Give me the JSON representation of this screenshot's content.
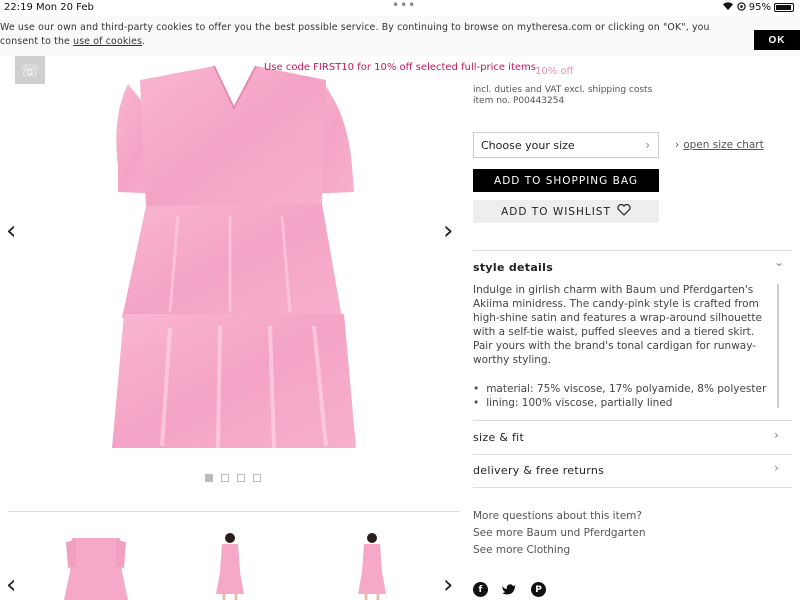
{
  "status_bar": {
    "time": "22:19",
    "date": "Mon 20 Feb",
    "dots": "•••",
    "battery": "95%"
  },
  "cookie_banner": {
    "text": "We use our own and third-party cookies to offer you the best possible service. By continuing to browse on mytheresa.com or clicking on \"OK\", you consent to the",
    "link": "use of cookies",
    "ok_label": "OK"
  },
  "promo": "Use code FIRST10 for 10% off selected full-price items",
  "product": {
    "price_badge": "10% off",
    "shipping": "incl. duties and VAT excl. shipping costs",
    "item_no": "item no. P00443254",
    "size_select": "Choose your size",
    "size_chart": "open size chart",
    "add_to_bag": "ADD TO SHOPPING BAG",
    "add_to_wishlist": "ADD TO WISHLIST"
  },
  "accordion": {
    "style_details": "style details",
    "description": "Indulge in girlish charm with Baum und Pferdgarten's Akiima minidress. The candy-pink style is crafted from high-shine satin and features a wrap-around silhouette with a self-tie waist, puffed sleeves and a tiered skirt. Pair yours with the brand's tonal cardigan for runway-worthy styling.",
    "bullets": [
      "material: 75% viscose, 17% polyamide, 8% polyester",
      "lining: 100% viscose, partially lined"
    ],
    "size_fit": "size & fit",
    "delivery": "delivery & free returns"
  },
  "more_links": {
    "questions": "More questions about this item?",
    "brand": "See more Baum und Pferdgarten",
    "category": "See more Clothing"
  },
  "gallery": {
    "image_count": 4,
    "active_index": 0
  },
  "colors": {
    "dress_pink": "#f7a9c9",
    "promo_red": "#c0185a"
  }
}
